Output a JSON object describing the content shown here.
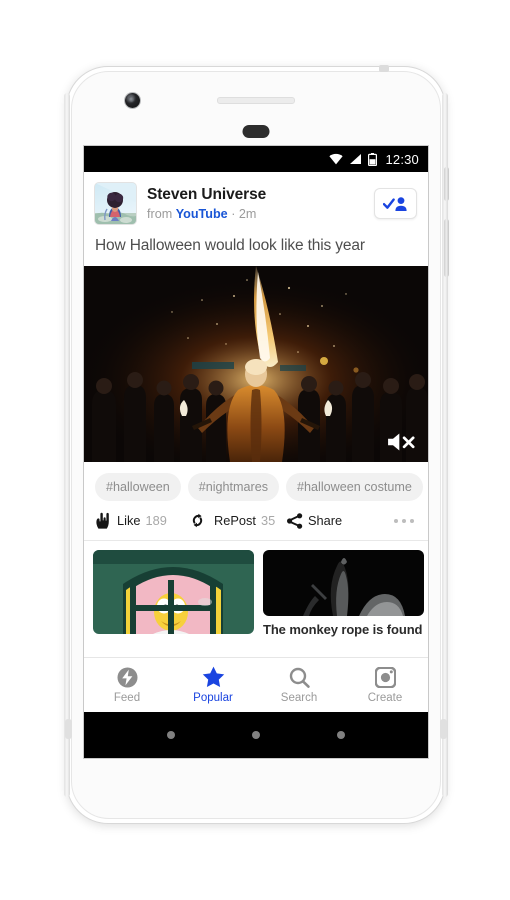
{
  "status_bar": {
    "time": "12:30",
    "icons": [
      "wifi-icon",
      "signal-icon",
      "battery-icon"
    ]
  },
  "post": {
    "author": "Steven Universe",
    "source_prefix": "from",
    "source": "YouTube",
    "separator": "·",
    "time_ago": "2m",
    "headline": "How Halloween would look like this year",
    "follow_button_label": "",
    "media": {
      "type": "video",
      "muted": true,
      "description": "fire breather performing at night in front of a crowd"
    },
    "tags": [
      "#halloween",
      "#nightmares",
      "#halloween costume"
    ],
    "actions": [
      {
        "label": "Like",
        "count": "189",
        "icon": "rock-hand-icon"
      },
      {
        "label": "RePost",
        "count": "35",
        "icon": "repost-icon"
      },
      {
        "label": "Share",
        "count": "",
        "icon": "share-icon"
      }
    ],
    "overflow_label": "•••"
  },
  "cards": [
    {
      "caption": "",
      "image": "cartoon-character-in-window"
    },
    {
      "caption": "The monkey rope is found",
      "image": "dark-smoke-figure"
    }
  ],
  "tabbar": {
    "items": [
      {
        "label": "Feed",
        "icon": "feed-icon",
        "active": false
      },
      {
        "label": "Popular",
        "icon": "star-icon",
        "active": true
      },
      {
        "label": "Search",
        "icon": "search-icon",
        "active": false
      },
      {
        "label": "Create",
        "icon": "camera-icon",
        "active": false
      }
    ]
  },
  "nav_bar": {
    "buttons": [
      "back-button",
      "home-button",
      "recents-button"
    ]
  },
  "colors": {
    "accent": "#1a44e0",
    "link": "#1a56d6",
    "tag_bg": "#f1f1f1",
    "tag_text": "#8d8d8d",
    "muted_text": "#9b9b9b",
    "status_bar_bg": "#000000"
  }
}
